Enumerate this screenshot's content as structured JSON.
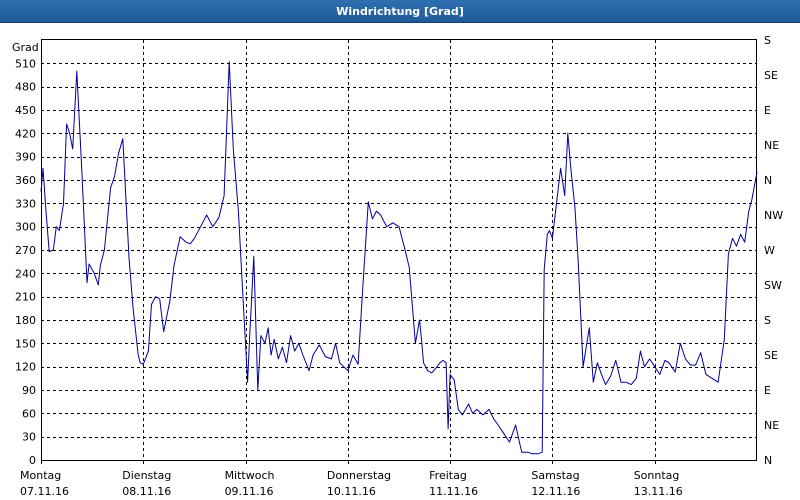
{
  "window": {
    "title": "Windrichtung [Grad]"
  },
  "chart_data": {
    "type": "line",
    "title": "Windrichtung [Grad]",
    "ylabel": "Grad",
    "ylim": [
      0,
      540
    ],
    "grid": true,
    "y_ticks": [
      0,
      30,
      60,
      90,
      120,
      150,
      180,
      210,
      240,
      270,
      300,
      330,
      360,
      390,
      420,
      450,
      480,
      510
    ],
    "y_right_ticks": [
      "N",
      "NE",
      "E",
      "SE",
      "S",
      "SW",
      "W",
      "NW",
      "N",
      "NE",
      "E",
      "SE",
      "S"
    ],
    "x_range_days": [
      0,
      7
    ],
    "x_ticks": [
      {
        "day": "Montag",
        "date": "07.11.16"
      },
      {
        "day": "Dienstag",
        "date": "08.11.16"
      },
      {
        "day": "Mittwoch",
        "date": "09.11.16"
      },
      {
        "day": "Donnerstag",
        "date": "10.11.16"
      },
      {
        "day": "Freitag",
        "date": "11.11.16"
      },
      {
        "day": "Samstag",
        "date": "12.11.16"
      },
      {
        "day": "Sonntag",
        "date": "13.11.16"
      }
    ],
    "series": [
      {
        "color": "#0000a0",
        "x": [
          0,
          0.02,
          0.05,
          0.08,
          0.12,
          0.15,
          0.18,
          0.22,
          0.25,
          0.28,
          0.31,
          0.35,
          0.4,
          0.45,
          0.47,
          0.52,
          0.56,
          0.58,
          0.62,
          0.68,
          0.72,
          0.76,
          0.8,
          0.86,
          0.9,
          0.95,
          0.97,
          1.0,
          1.05,
          1.08,
          1.12,
          1.16,
          1.2,
          1.26,
          1.3,
          1.36,
          1.42,
          1.46,
          1.5,
          1.56,
          1.62,
          1.68,
          1.74,
          1.79,
          1.84,
          1.88,
          1.93,
          1.97,
          2.0,
          2.02,
          2.04,
          2.08,
          2.12,
          2.15,
          2.19,
          2.22,
          2.25,
          2.28,
          2.32,
          2.36,
          2.4,
          2.44,
          2.48,
          2.52,
          2.56,
          2.62,
          2.66,
          2.72,
          2.78,
          2.84,
          2.88,
          2.92,
          2.96,
          3.0,
          3.05,
          3.1,
          3.15,
          3.2,
          3.24,
          3.28,
          3.32,
          3.38,
          3.44,
          3.5,
          3.55,
          3.6,
          3.66,
          3.7,
          3.72,
          3.74,
          3.78,
          3.82,
          3.86,
          3.9,
          3.93,
          3.96,
          3.98,
          4.0,
          4.04,
          4.08,
          4.12,
          4.18,
          4.22,
          4.26,
          4.32,
          4.38,
          4.43,
          4.47,
          4.52,
          4.58,
          4.64,
          4.7,
          4.76,
          4.8,
          4.86,
          4.9,
          4.92,
          4.95,
          4.97,
          5.0,
          5.04,
          5.08,
          5.12,
          5.15,
          5.18,
          5.22,
          5.25,
          5.3,
          5.36,
          5.4,
          5.44,
          5.48,
          5.52,
          5.57,
          5.62,
          5.67,
          5.72,
          5.77,
          5.82,
          5.86,
          5.9,
          5.95,
          6.0,
          6.05,
          6.1,
          6.14,
          6.2,
          6.25,
          6.3,
          6.35,
          6.4,
          6.45,
          6.5,
          6.56,
          6.62,
          6.68,
          6.72,
          6.76,
          6.8,
          6.84,
          6.88,
          6.92,
          6.95,
          7.0
        ],
        "values": [
          345,
          375,
          318,
          268,
          270,
          300,
          295,
          330,
          432,
          420,
          400,
          500,
          370,
          228,
          252,
          240,
          225,
          250,
          270,
          350,
          365,
          395,
          413,
          260,
          195,
          135,
          125,
          123,
          140,
          200,
          210,
          207,
          165,
          205,
          250,
          287,
          280,
          278,
          285,
          300,
          315,
          300,
          312,
          340,
          512,
          400,
          320,
          220,
          148,
          100,
          160,
          262,
          90,
          160,
          150,
          170,
          135,
          155,
          130,
          145,
          125,
          160,
          140,
          150,
          135,
          115,
          135,
          148,
          133,
          130,
          150,
          125,
          120,
          115,
          135,
          123,
          230,
          332,
          310,
          320,
          315,
          300,
          305,
          300,
          275,
          248,
          150,
          180,
          155,
          125,
          115,
          112,
          118,
          125,
          128,
          125,
          40,
          110,
          103,
          65,
          58,
          72,
          60,
          65,
          58,
          65,
          52,
          45,
          35,
          23,
          45,
          10,
          10,
          8,
          8,
          10,
          245,
          290,
          295,
          285,
          330,
          375,
          340,
          420,
          375,
          325,
          260,
          120,
          170,
          100,
          125,
          110,
          97,
          108,
          128,
          100,
          100,
          97,
          105,
          140,
          120,
          130,
          120,
          110,
          128,
          125,
          113,
          150,
          130,
          122,
          122,
          138,
          110,
          105,
          100,
          155,
          265,
          285,
          275,
          290,
          280,
          320,
          335,
          370
        ]
      }
    ]
  }
}
